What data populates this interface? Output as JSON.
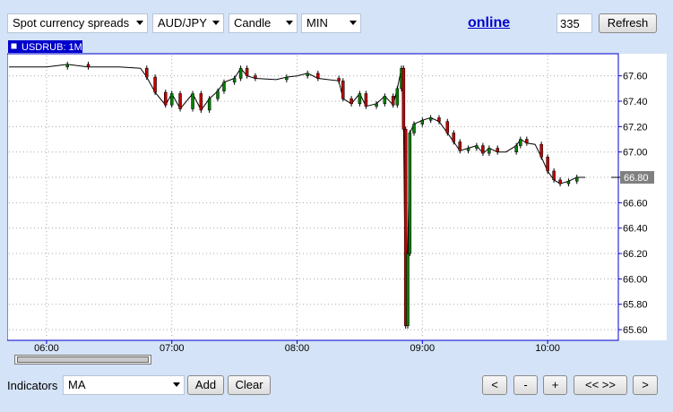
{
  "toolbar": {
    "market": "Spot currency spreads",
    "symbol": "AUD/JPY",
    "chart_style": "Candle",
    "timeframe": "MIN",
    "online_label": "online",
    "period_value": "335",
    "refresh_label": "Refresh"
  },
  "chart_data": {
    "type": "candlestick",
    "title": "USDRUB: 1M",
    "time_range": [
      "05:42",
      "10:33"
    ],
    "x_tick_labels": [
      "06:00",
      "07:00",
      "08:00",
      "09:00",
      "10:00"
    ],
    "y_tick_labels": [
      "67.60",
      "67.40",
      "67.20",
      "67.00",
      "66.80",
      "66.60",
      "66.40",
      "66.20",
      "66.00",
      "65.80",
      "65.60"
    ],
    "y_range": [
      65.53,
      67.76
    ],
    "last_price": "66.80",
    "grid": true,
    "colors": {
      "up": "#008000",
      "down": "#c00000",
      "neutral": "#000000",
      "title_bg": "#0000cc",
      "last_price_bg": "#808080"
    },
    "series": [
      {
        "t": "05:42",
        "v": 67.67
      },
      {
        "t": "06:00",
        "v": 67.67
      },
      {
        "t": "06:10",
        "v": 67.69
      },
      {
        "t": "06:20",
        "v": 67.67
      },
      {
        "t": "06:35",
        "v": 67.67
      },
      {
        "t": "06:45",
        "v": 67.66
      },
      {
        "t": "06:48",
        "v": 67.59
      },
      {
        "t": "06:52",
        "v": 67.47
      },
      {
        "t": "06:57",
        "v": 67.37
      },
      {
        "t": "07:00",
        "v": 67.46
      },
      {
        "t": "07:04",
        "v": 67.34
      },
      {
        "t": "07:10",
        "v": 67.46
      },
      {
        "t": "07:14",
        "v": 67.33
      },
      {
        "t": "07:18",
        "v": 67.42
      },
      {
        "t": "07:22",
        "v": 67.48
      },
      {
        "t": "07:25",
        "v": 67.55
      },
      {
        "t": "07:30",
        "v": 67.58
      },
      {
        "t": "07:33",
        "v": 67.66
      },
      {
        "t": "07:36",
        "v": 67.6
      },
      {
        "t": "07:40",
        "v": 67.58
      },
      {
        "t": "07:50",
        "v": 67.57
      },
      {
        "t": "07:55",
        "v": 67.59
      },
      {
        "t": "08:00",
        "v": 67.6
      },
      {
        "t": "08:05",
        "v": 67.62
      },
      {
        "t": "08:10",
        "v": 67.58
      },
      {
        "t": "08:20",
        "v": 67.56
      },
      {
        "t": "08:22",
        "v": 67.42
      },
      {
        "t": "08:26",
        "v": 67.38
      },
      {
        "t": "08:30",
        "v": 67.46
      },
      {
        "t": "08:33",
        "v": 67.36
      },
      {
        "t": "08:38",
        "v": 67.38
      },
      {
        "t": "08:42",
        "v": 67.44
      },
      {
        "t": "08:46",
        "v": 67.37
      },
      {
        "t": "08:48",
        "v": 67.5
      },
      {
        "t": "08:50",
        "v": 67.66
      },
      {
        "t": "08:51",
        "v": 67.18
      },
      {
        "t": "08:52",
        "v": 65.63
      },
      {
        "t": "08:53",
        "v": 66.2
      },
      {
        "t": "08:54",
        "v": 67.15
      },
      {
        "t": "08:56",
        "v": 67.22
      },
      {
        "t": "09:00",
        "v": 67.25
      },
      {
        "t": "09:04",
        "v": 67.27
      },
      {
        "t": "09:08",
        "v": 67.24
      },
      {
        "t": "09:12",
        "v": 67.15
      },
      {
        "t": "09:15",
        "v": 67.08
      },
      {
        "t": "09:18",
        "v": 67.01
      },
      {
        "t": "09:22",
        "v": 67.03
      },
      {
        "t": "09:26",
        "v": 67.05
      },
      {
        "t": "09:29",
        "v": 66.99
      },
      {
        "t": "09:32",
        "v": 67.03
      },
      {
        "t": "09:36",
        "v": 67.0
      },
      {
        "t": "09:40",
        "v": 67.0
      },
      {
        "t": "09:45",
        "v": 67.05
      },
      {
        "t": "09:47",
        "v": 67.1
      },
      {
        "t": "09:50",
        "v": 67.07
      },
      {
        "t": "09:54",
        "v": 67.06
      },
      {
        "t": "09:57",
        "v": 66.96
      },
      {
        "t": "10:00",
        "v": 66.85
      },
      {
        "t": "10:03",
        "v": 66.78
      },
      {
        "t": "10:06",
        "v": 66.75
      },
      {
        "t": "10:10",
        "v": 66.77
      },
      {
        "t": "10:14",
        "v": 66.8
      },
      {
        "t": "10:18",
        "v": 66.8
      }
    ]
  },
  "bottom": {
    "indicators_label": "Indicators",
    "indicator_selected": "MA",
    "add_label": "Add",
    "clear_label": "Clear",
    "nav_prev": "<",
    "zoom_out": "-",
    "zoom_in": "+",
    "nav_fit": "<< >>",
    "nav_next": ">"
  }
}
